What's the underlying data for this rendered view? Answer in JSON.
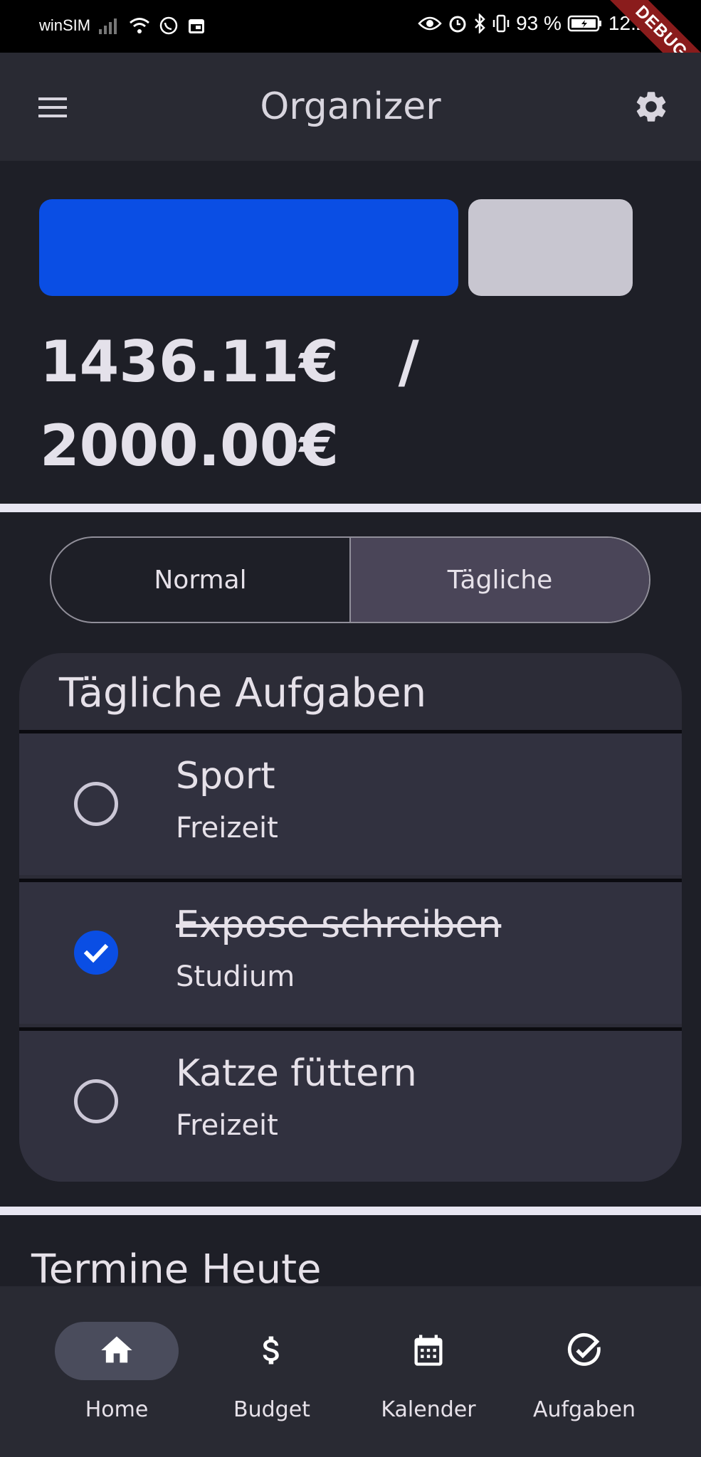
{
  "status_bar": {
    "carrier": "winSIM",
    "battery": "93 %",
    "time": "12:27",
    "debug_label": "DEBUG"
  },
  "app_bar": {
    "title": "Organizer",
    "menu_icon": "menu-icon",
    "settings_icon": "gear-icon"
  },
  "budget": {
    "spent": "1436.11€",
    "separator": "/",
    "total": "2000.00€",
    "spent_fraction": 0.718,
    "colors": {
      "spent": "#0a4ee4",
      "remaining": "#c8c6d0"
    }
  },
  "segmented": {
    "options": [
      "Normal",
      "Tägliche"
    ],
    "selected": "Tägliche"
  },
  "daily_tasks": {
    "title": "Tägliche Aufgaben",
    "items": [
      {
        "title": "Sport",
        "category": "Freizeit",
        "done": false
      },
      {
        "title": "Expose schreiben",
        "category": "Studium",
        "done": true
      },
      {
        "title": "Katze füttern",
        "category": "Freizeit",
        "done": false
      }
    ]
  },
  "appointments": {
    "title": "Termine Heute"
  },
  "bottom_nav": {
    "items": [
      {
        "label": "Home",
        "icon": "home-icon",
        "active": true
      },
      {
        "label": "Budget",
        "icon": "dollar-icon",
        "active": false
      },
      {
        "label": "Kalender",
        "icon": "calendar-icon",
        "active": false
      },
      {
        "label": "Aufgaben",
        "icon": "check-circle-icon",
        "active": false
      }
    ]
  }
}
